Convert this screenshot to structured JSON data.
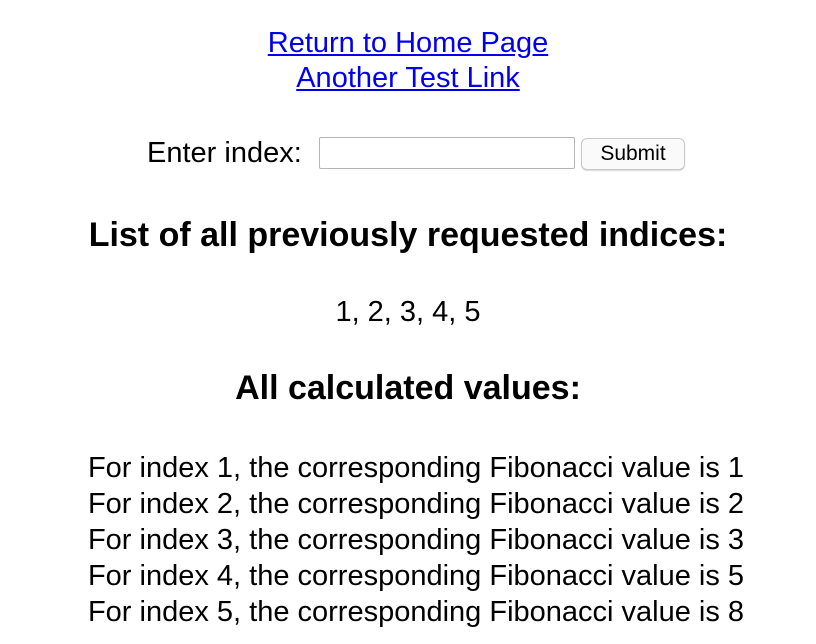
{
  "nav": {
    "home_link": "Return to Home Page",
    "test_link": "Another Test Link"
  },
  "form": {
    "label": "Enter index:",
    "input_value": "",
    "submit_label": "Submit"
  },
  "indices": {
    "heading": "List of all previously requested indices:",
    "list_text": "1, 2, 3, 4, 5"
  },
  "values": {
    "heading": "All calculated values:",
    "items": [
      "For index 1, the corresponding Fibonacci value is 1",
      "For index 2, the corresponding Fibonacci value is 2",
      "For index 3, the corresponding Fibonacci value is 3",
      "For index 4, the corresponding Fibonacci value is 5",
      "For index 5, the corresponding Fibonacci value is 8"
    ]
  }
}
